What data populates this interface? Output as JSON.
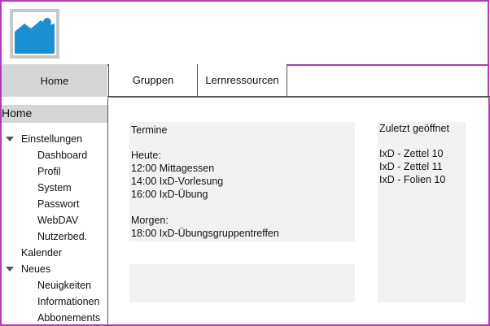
{
  "nav": {
    "home": "Home",
    "tabs": [
      "Gruppen",
      "Lernressourcen"
    ]
  },
  "sidebar": {
    "home": "Home",
    "einstellungen": {
      "label": "Einstellungen",
      "children": [
        "Dashboard",
        "Profil",
        "System",
        "Passwort",
        "WebDAV",
        "Nutzerbed."
      ]
    },
    "kalender": "Kalender",
    "neues": {
      "label": "Neues",
      "children": [
        "Neuigkeiten",
        "Informationen",
        "Abbonements"
      ]
    }
  },
  "termine": {
    "title": "Termine",
    "heute_label": "Heute:",
    "heute": [
      "12:00 Mittagessen",
      "14:00 IxD-Vorlesung",
      "16:00 IxD-Übung"
    ],
    "morgen_label": "Morgen:",
    "morgen": [
      "18:00 IxD-Übungsgruppentreffen"
    ]
  },
  "zuletzt": {
    "title": "Zuletzt geöffnet",
    "items": [
      "IxD - Zettel 10",
      "IxD - Zettel 11",
      "IxD - Folien 10"
    ]
  },
  "colors": {
    "frame": "#b23ab8",
    "logo_blue": "#1a8fd1",
    "panel": "#f2f2f2",
    "nav_active": "#d6d6d6"
  }
}
